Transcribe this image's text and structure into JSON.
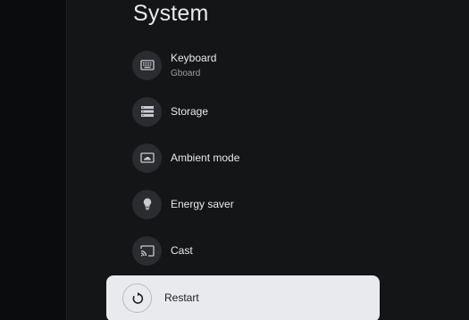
{
  "screen": {
    "title": "System"
  },
  "menu": {
    "items": [
      {
        "label": "Keyboard",
        "sub": "Gboard",
        "icon": "keyboard-icon"
      },
      {
        "label": "Storage",
        "icon": "storage-icon"
      },
      {
        "label": "Ambient mode",
        "icon": "ambient-mode-icon"
      },
      {
        "label": "Energy saver",
        "icon": "lightbulb-icon"
      },
      {
        "label": "Cast",
        "icon": "cast-icon"
      },
      {
        "label": "Restart",
        "icon": "restart-icon",
        "focused": true
      }
    ]
  },
  "colors": {
    "background": "#0e0f11",
    "panel": "#141517",
    "icon_bg": "#2a2c2f",
    "text": "#e8eaed",
    "subtext": "#9aa0a6",
    "focus_bg": "#e8eaed",
    "focus_text": "#202124"
  }
}
